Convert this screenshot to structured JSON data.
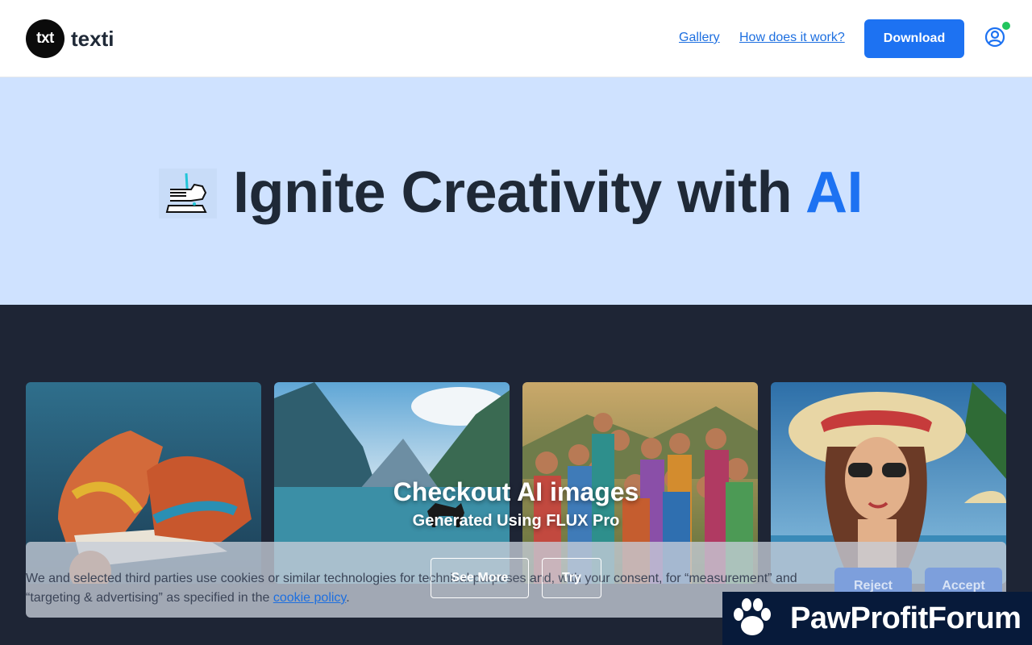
{
  "header": {
    "logo_badge": "txt",
    "logo_text": "texti",
    "nav": {
      "gallery": "Gallery",
      "how": "How does it work?"
    },
    "download_label": "Download",
    "user_icon": "user-circle-icon"
  },
  "hero": {
    "icon": "hand-writing-icon",
    "title_prefix": "Ignite Creativity with ",
    "title_accent": "AI"
  },
  "gallery": {
    "cards": [
      "Sneakers",
      "Mountain lake with horse",
      "Children in colorful clothing",
      "Woman in sun hat at beach"
    ],
    "overlay_title": "Checkout AI images",
    "overlay_subtitle": "Generated Using FLUX Pro",
    "see_more_label": "See More",
    "try_label": "Try"
  },
  "cookie": {
    "text_before": "We and selected third parties use cookies or similar technologies for technical purposes and, with your consent, for “measurement” and “targeting & advertising” as specified in the ",
    "link_label": "cookie policy",
    "text_after": ".",
    "reject_label": "Reject",
    "accept_label": "Accept"
  },
  "watermark": {
    "text": "PawProfitForum",
    "icon": "paw-icon"
  },
  "colors": {
    "accent": "#1d72f2",
    "hero_bg": "#cfe2ff",
    "dark_bg": "#1e2535",
    "online": "#22c55e"
  }
}
